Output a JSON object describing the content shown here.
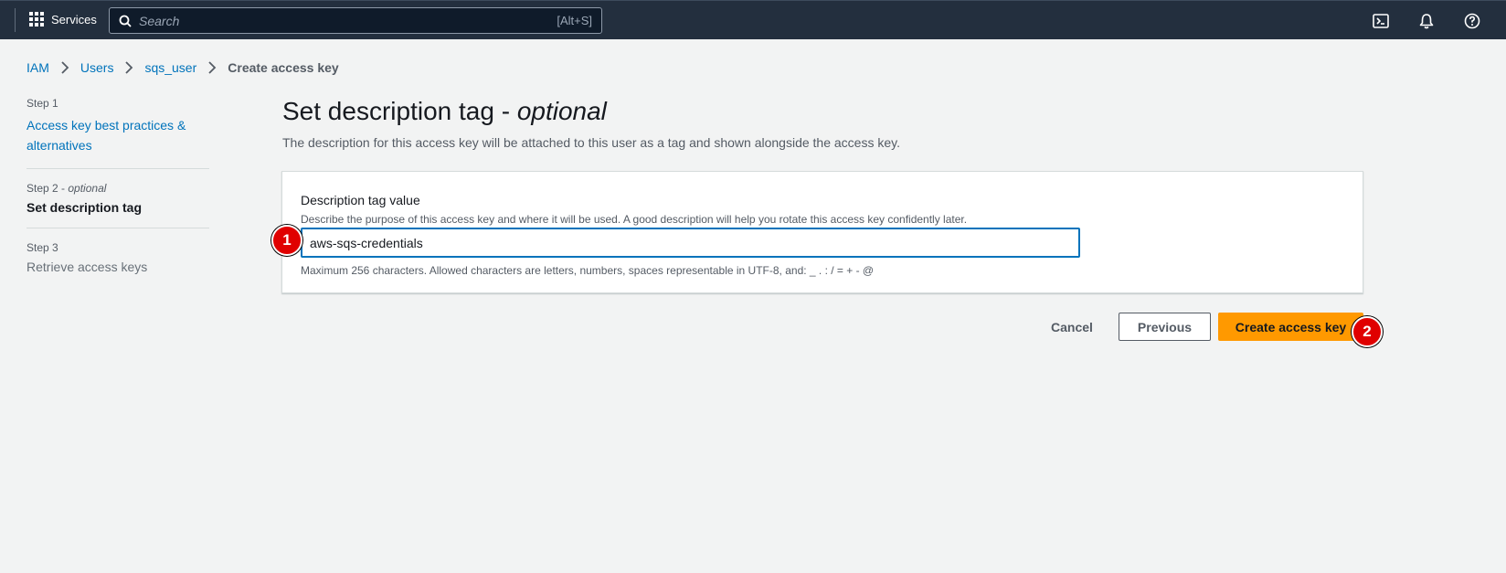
{
  "topnav": {
    "services_label": "Services",
    "search_placeholder": "Search",
    "search_shortcut": "[Alt+S]",
    "icons": [
      "grid-icon",
      "search-icon",
      "cloudshell-icon",
      "bell-icon",
      "help-icon"
    ]
  },
  "breadcrumb": {
    "items": [
      "IAM",
      "Users",
      "sqs_user"
    ],
    "current": "Create access key"
  },
  "steps": [
    {
      "label": "Step 1",
      "title": "Access key best practices & alternatives"
    },
    {
      "label": "Step 2",
      "label_suffix": "optional",
      "title": "Set description tag"
    },
    {
      "label": "Step 3",
      "title": "Retrieve access keys"
    }
  ],
  "main": {
    "title": "Set description tag - ",
    "title_emphasis": "optional",
    "description": "The description for this access key will be attached to this user as a tag and shown alongside the access key.",
    "field": {
      "label": "Description tag value",
      "description": "Describe the purpose of this access key and where it will be used. A good description will help you rotate this access key confidently later.",
      "value": "aws-sqs-credentials",
      "constraint": "Maximum 256 characters. Allowed characters are letters, numbers, spaces representable in UTF-8, and: _ . : / = + - @"
    }
  },
  "actions": {
    "cancel": "Cancel",
    "previous": "Previous",
    "create": "Create access key"
  },
  "markers": [
    "1",
    "2"
  ],
  "colors": {
    "nav_bg": "#232f3e",
    "link": "#0073bb",
    "primary_button": "#ff9900",
    "marker": "#e00000"
  }
}
